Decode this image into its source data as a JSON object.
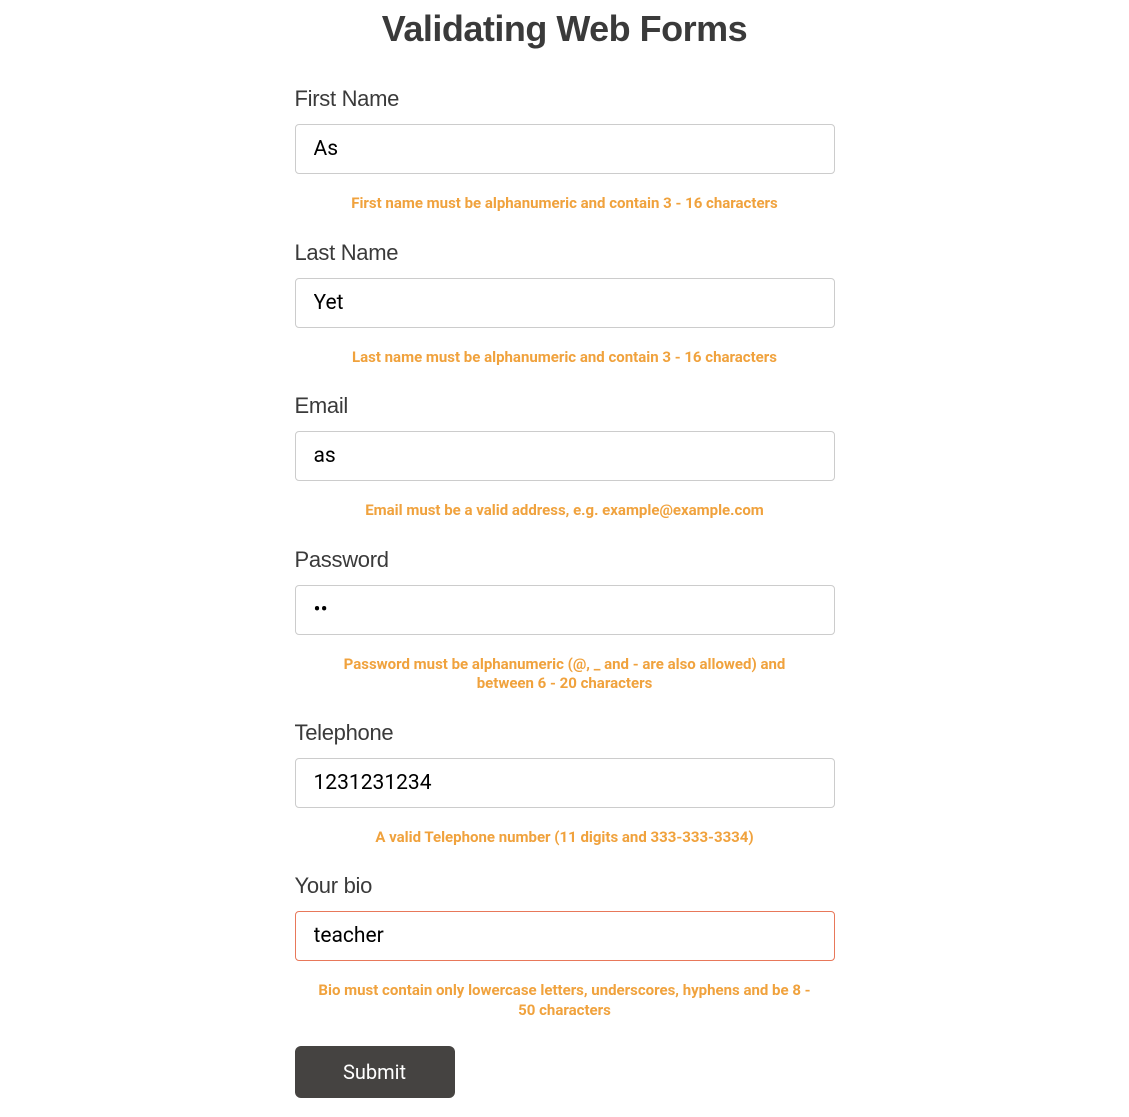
{
  "title": "Validating Web Forms",
  "fields": {
    "firstName": {
      "label": "First Name",
      "value": "As",
      "help": "First name must be alphanumeric and contain 3 - 16 characters"
    },
    "lastName": {
      "label": "Last Name",
      "value": "Yet",
      "help": "Last name must be alphanumeric and contain 3 - 16 characters"
    },
    "email": {
      "label": "Email",
      "value": "as",
      "help": "Email must be a valid address, e.g. example@example.com"
    },
    "password": {
      "label": "Password",
      "value": "••",
      "help": "Password must be alphanumeric (@, _ and - are also allowed) and between 6 - 20 characters"
    },
    "telephone": {
      "label": "Telephone",
      "value": "1231231234",
      "help": "A valid Telephone number (11 digits and 333-333-3334)"
    },
    "bio": {
      "label": "Your bio",
      "value": "teacher",
      "help": "Bio must contain only lowercase letters, underscores, hyphens and be 8 - 50 characters"
    }
  },
  "submit": {
    "label": "Submit"
  }
}
